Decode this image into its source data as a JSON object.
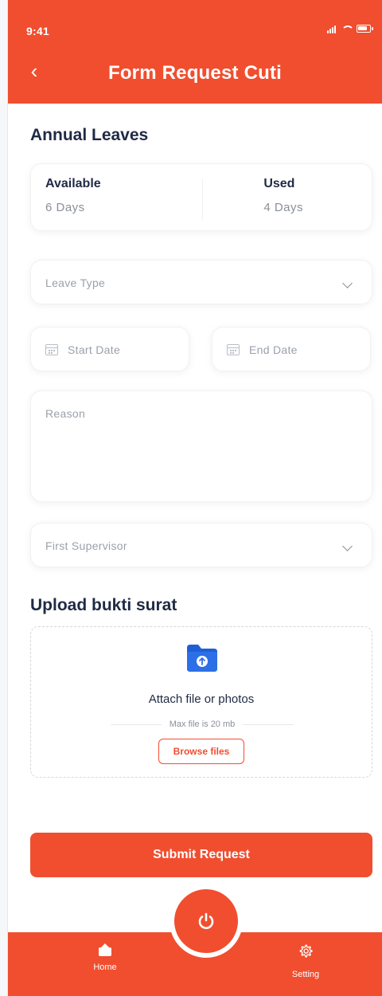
{
  "status_bar": {
    "time": "9:41"
  },
  "header": {
    "title": "Form Request Cuti",
    "back_symbol": "‹"
  },
  "annual_leaves": {
    "title": "Annual Leaves",
    "available_label": "Available",
    "available_value": "6 Days",
    "used_label": "Used",
    "used_value": "4 Days"
  },
  "form": {
    "leave_type_placeholder": "Leave Type",
    "start_date_placeholder": "Start Date",
    "end_date_placeholder": "End Date",
    "reason_placeholder": "Reason",
    "supervisor_placeholder": "First Supervisor"
  },
  "upload": {
    "title": "Upload bukti surat",
    "attach_label": "Attach file or photos",
    "max_file_label": "Max file is 20 mb",
    "browse_label": "Browse files"
  },
  "submit_label": "Submit Request",
  "bottom_nav": {
    "home_label": "Home",
    "setting_label": "Setting"
  },
  "colors": {
    "primary": "#f04e2f",
    "text_dark": "#1f2a44",
    "muted": "#9aa1ab",
    "folder_blue": "#1f5fd6"
  },
  "icons": {
    "back": "chevron-left-icon",
    "dropdown": "chevron-down-icon",
    "calendar": "calendar-icon",
    "upload_folder": "folder-upload-icon",
    "home": "home-icon",
    "setting": "gear-icon",
    "power": "power-icon"
  }
}
